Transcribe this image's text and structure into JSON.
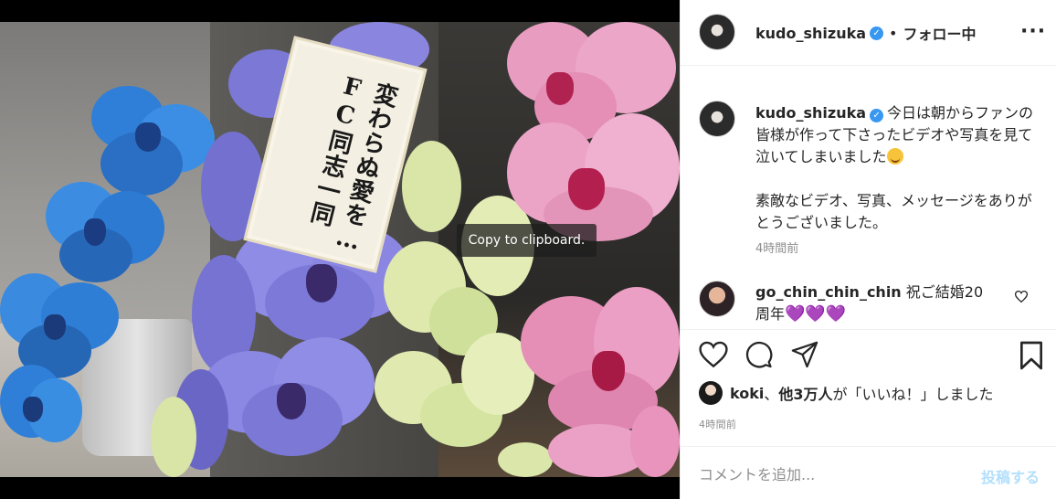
{
  "media": {
    "tag_lines": [
      "変わらぬ愛を…",
      "FC同志一同"
    ],
    "toast": "Copy to clipboard."
  },
  "header": {
    "username": "kudo_shizuka",
    "separator": "•",
    "follow_status": "フォロー中",
    "more_icon": "more-horizontal-icon"
  },
  "caption": {
    "username": "kudo_shizuka",
    "text_part1": "今日は朝からファンの皆様が作って下さったビデオや写真を見て泣いてしまいました",
    "emoji": "smiling-face-emoji",
    "text_part2": "素敵なビデオ、写真、メッセージをありがとうございました。",
    "time": "4時間前"
  },
  "comments": [
    {
      "username": "go_chin_chin_chin",
      "text": "祝ご結婚20周年",
      "emojis": "💜💜💜"
    }
  ],
  "actions": {
    "like_icon": "heart-icon",
    "comment_icon": "comment-icon",
    "share_icon": "paper-plane-icon",
    "save_icon": "bookmark-icon"
  },
  "likes": {
    "liker": "koki",
    "sep": "、",
    "others": "他3万人",
    "suffix": "が「いいね！」しました"
  },
  "post_time": "4時間前",
  "comment_form": {
    "placeholder": "コメントを追加...",
    "post_label": "投稿する"
  },
  "colors": {
    "verified": "#3897f0",
    "post_button": "#b2dffc",
    "muted": "#8e8e8e"
  }
}
